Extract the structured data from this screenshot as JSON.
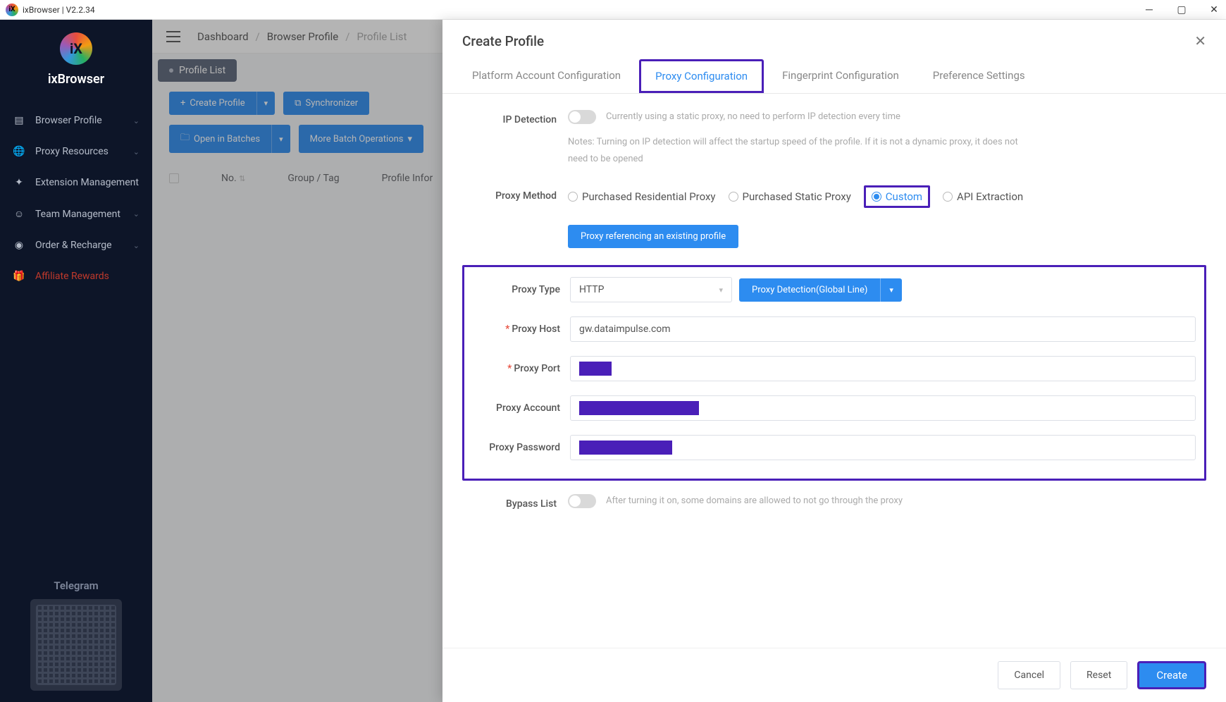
{
  "title": "ixBrowser | V2.2.34",
  "brand": "ixBrowser",
  "nav": {
    "browser_profile": "Browser Profile",
    "proxy_resources": "Proxy Resources",
    "extension_management": "Extension Management",
    "team_management": "Team Management",
    "order_recharge": "Order & Recharge",
    "affiliate_rewards": "Affiliate Rewards"
  },
  "telegram": "Telegram",
  "breadcrumb": {
    "a": "Dashboard",
    "b": "Browser Profile",
    "c": "Profile List"
  },
  "tabpill": "Profile List",
  "toolbar": {
    "create_profile": "Create Profile",
    "synchronizer": "Synchronizer",
    "open_batches": "Open in Batches",
    "more_batch": "More Batch Operations"
  },
  "table": {
    "no": "No.",
    "group": "Group / Tag",
    "info": "Profile Infor"
  },
  "panel": {
    "title": "Create Profile",
    "tabs": {
      "platform": "Platform Account Configuration",
      "proxy": "Proxy Configuration",
      "fingerprint": "Fingerprint Configuration",
      "preference": "Preference Settings"
    },
    "ip_detection": {
      "label": "IP Detection",
      "hint": "Currently using a static proxy, no need to perform IP detection every time",
      "notes": "Notes: Turning on IP detection will affect the startup speed of the profile. If it is not a dynamic proxy, it does not need to be opened"
    },
    "proxy_method": {
      "label": "Proxy Method",
      "opt1": "Purchased Residential Proxy",
      "opt2": "Purchased Static Proxy",
      "opt3": "Custom",
      "opt4": "API Extraction"
    },
    "ref_btn": "Proxy referencing an existing profile",
    "proxy_type": {
      "label": "Proxy Type",
      "value": "HTTP",
      "detect": "Proxy Detection(Global Line)"
    },
    "proxy_host": {
      "label": "Proxy Host",
      "value": "gw.dataimpulse.com"
    },
    "proxy_port": {
      "label": "Proxy Port"
    },
    "proxy_account": {
      "label": "Proxy Account"
    },
    "proxy_password": {
      "label": "Proxy Password"
    },
    "bypass": {
      "label": "Bypass List",
      "hint": "After turning it on, some domains are allowed to not go through the proxy"
    },
    "footer": {
      "cancel": "Cancel",
      "reset": "Reset",
      "create": "Create"
    }
  }
}
